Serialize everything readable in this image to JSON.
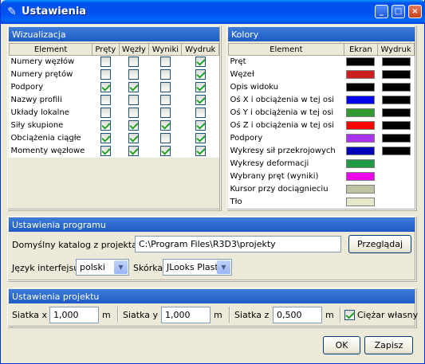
{
  "window": {
    "title": "Ustawienia",
    "buttons": [
      "_",
      "□",
      "×"
    ]
  },
  "visualization": {
    "title": "Wizualizacja",
    "columns": [
      "Element",
      "Pręty",
      "Węzły",
      "Wyniki",
      "Wydruk"
    ],
    "rows": [
      {
        "label": "Numery węzłów",
        "checks": [
          false,
          false,
          false,
          true
        ]
      },
      {
        "label": "Numery prętów",
        "checks": [
          false,
          false,
          false,
          true
        ]
      },
      {
        "label": "Podpory",
        "checks": [
          true,
          true,
          false,
          true
        ]
      },
      {
        "label": "Nazwy profili",
        "checks": [
          false,
          false,
          false,
          true
        ]
      },
      {
        "label": "Układy lokalne",
        "checks": [
          false,
          false,
          false,
          false
        ]
      },
      {
        "label": "Siły skupione",
        "checks": [
          true,
          true,
          true,
          true
        ]
      },
      {
        "label": "Obciążenia ciągłe",
        "checks": [
          true,
          true,
          false,
          true
        ]
      },
      {
        "label": "Momenty węzłowe",
        "checks": [
          true,
          true,
          true,
          true
        ]
      }
    ]
  },
  "colors": {
    "title": "Kolory",
    "columns": [
      "Element",
      "Ekran",
      "Wydruk"
    ],
    "rows": [
      {
        "label": "Pręt",
        "screen": "#000000",
        "print": "#000000"
      },
      {
        "label": "Węzeł",
        "screen": "#cc2020",
        "print": "#000000"
      },
      {
        "label": "Opis widoku",
        "screen": "#000000",
        "print": "#000000"
      },
      {
        "label": "Oś X i obciążenia w tej osi",
        "screen": "#0000ee",
        "print": "#000000"
      },
      {
        "label": "Oś Y i obciążenia w tej osi",
        "screen": "#339933",
        "print": "#000000"
      },
      {
        "label": "Oś Z i obciążenia w tej osi",
        "screen": "#ff0000",
        "print": "#000000"
      },
      {
        "label": "Podpory",
        "screen": "#aa33ee",
        "print": "#000000"
      },
      {
        "label": "Wykresy sił przekrojowych",
        "screen": "#0000bb",
        "print": "#000000"
      },
      {
        "label": "Wykresy deformacji",
        "screen": "#229944",
        "print": ""
      },
      {
        "label": "Wybrany pręt (wyniki)",
        "screen": "#ee00ee",
        "print": ""
      },
      {
        "label": "Kursor przy dociągnieciu",
        "screen": "#bbc3a3",
        "print": ""
      },
      {
        "label": "Tło",
        "screen": "#e6e6c8",
        "print": ""
      }
    ]
  },
  "program": {
    "title": "Ustawienia programu",
    "dir_label": "Domyślny katalog z projektami",
    "dir_value": "C:\\Program Files\\R3D3\\projekty",
    "browse_label": "Przeglądaj",
    "lang_label": "Język interfejsu",
    "lang_value": "polski",
    "skin_label": "Skórka",
    "skin_value": "JLooks Plastic"
  },
  "project": {
    "title": "Ustawienia projektu",
    "grid_x_label": "Siatka x",
    "grid_x_value": "1,000",
    "grid_y_label": "Siatka y",
    "grid_y_value": "1,000",
    "grid_z_label": "Siatka z",
    "grid_z_value": "0,500",
    "unit": "m",
    "weight_label": "Ciężar własny",
    "weight_checked": true
  },
  "footer": {
    "ok_label": "OK",
    "save_label": "Zapisz"
  }
}
